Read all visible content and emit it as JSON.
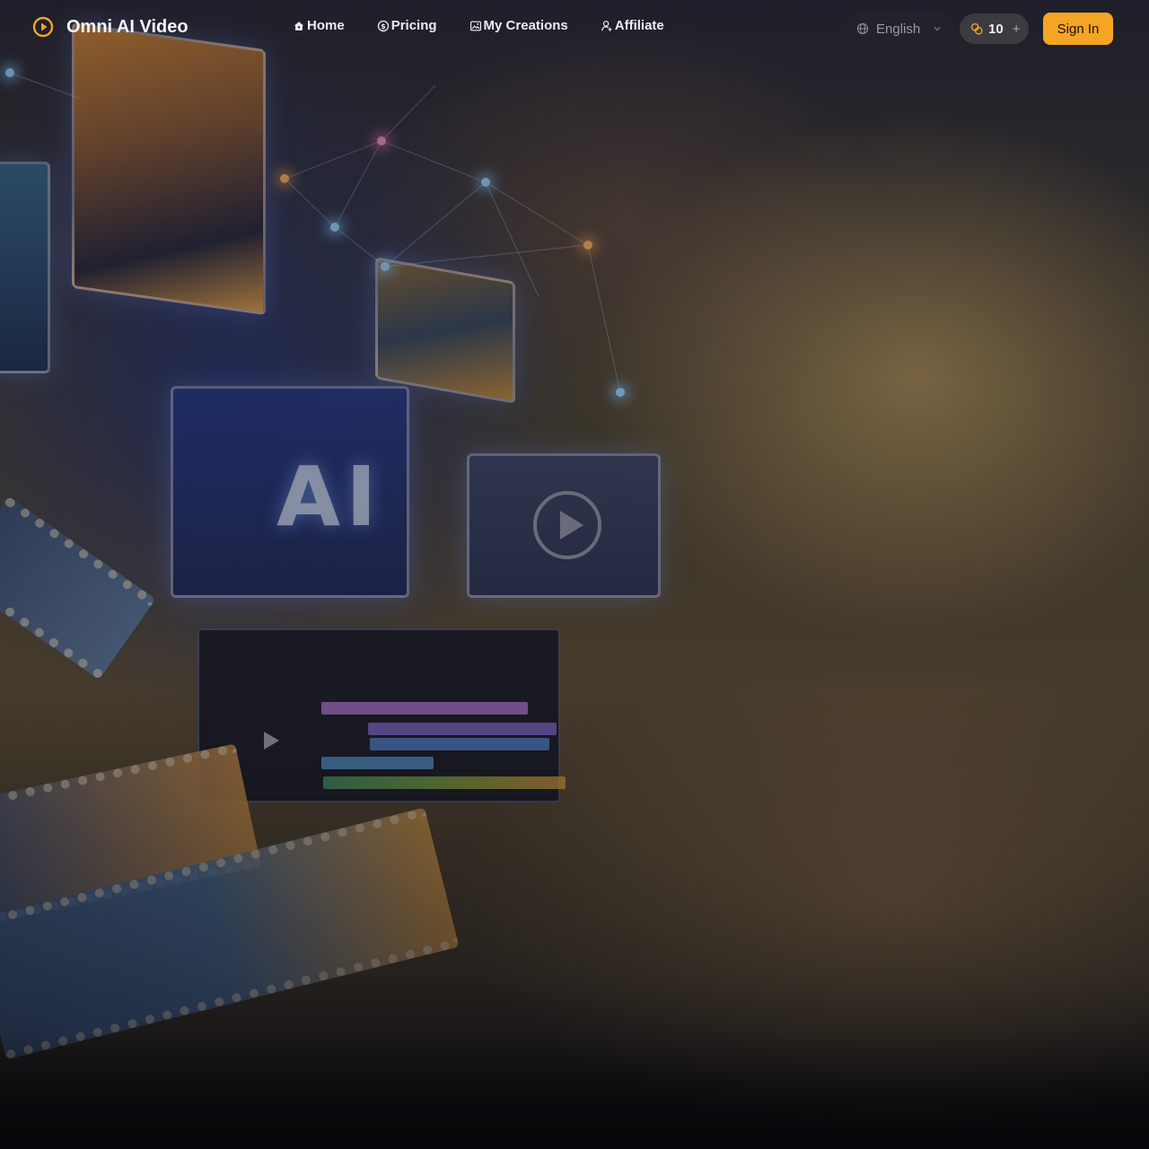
{
  "brand": {
    "name": "Omni AI Video",
    "icon": "play-circle-icon",
    "accent_color": "#f5a524"
  },
  "nav": {
    "items": [
      {
        "label": "Home",
        "icon": "home-icon"
      },
      {
        "label": "Pricing",
        "icon": "dollar-circle-icon"
      },
      {
        "label": "My Creations",
        "icon": "gallery-icon"
      },
      {
        "label": "Affiliate",
        "icon": "user-plus-icon"
      }
    ]
  },
  "language": {
    "selected": "English",
    "icon": "globe-icon"
  },
  "credits": {
    "count": "10",
    "add_label": "+",
    "icon": "coins-icon"
  },
  "auth": {
    "signin_label": "Sign In"
  },
  "hero_art": {
    "overlay_text": "AI"
  }
}
